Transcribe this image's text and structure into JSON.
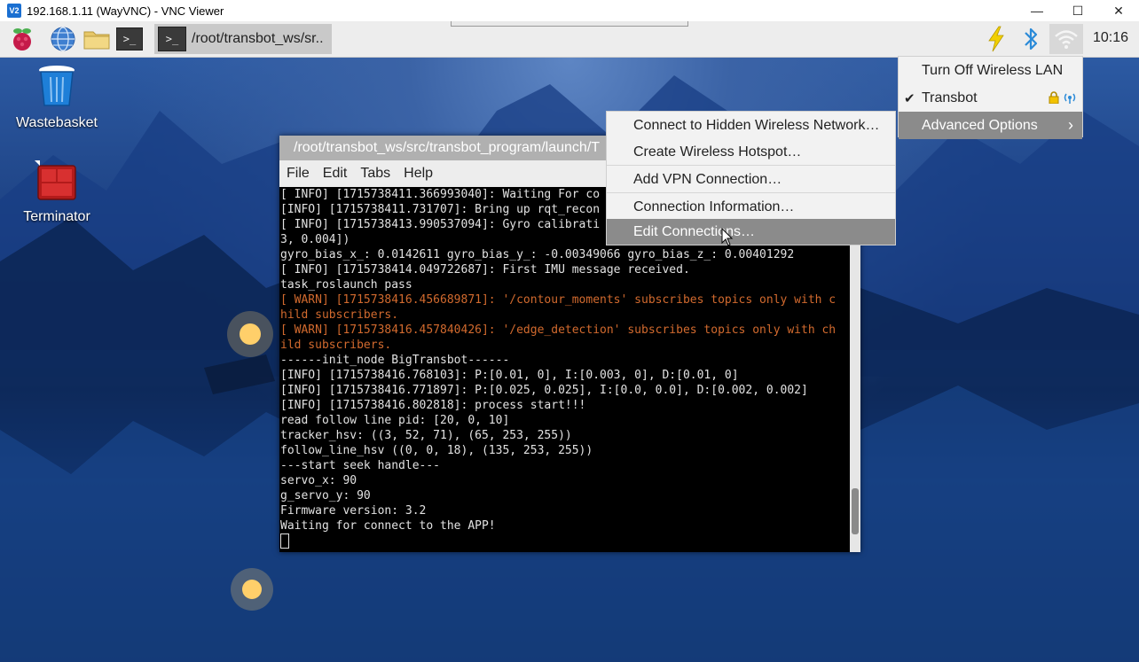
{
  "vnc": {
    "title": "192.168.1.11 (WayVNC) - VNC Viewer",
    "logo": "V2",
    "minimize": "—",
    "maximize": "☐",
    "close": "✕"
  },
  "taskbar": {
    "launchers": [
      "raspberry-pi-menu-icon",
      "web-browser-icon",
      "file-manager-icon",
      "terminal-icon"
    ],
    "task_title": "/root/transbot_ws/sr..",
    "clock": "10:16",
    "tray_icons": [
      "lightning-icon",
      "bluetooth-icon",
      "wifi-icon"
    ]
  },
  "desktop": {
    "icons": [
      {
        "label": "Wastebasket"
      },
      {
        "label": "Terminator"
      }
    ]
  },
  "terminal": {
    "title": "/root/transbot_ws/src/transbot_program/launch/T",
    "menu": [
      "File",
      "Edit",
      "Tabs",
      "Help"
    ],
    "lines": [
      {
        "text": "[ INFO] [1715738411.366993040]: Waiting For co",
        "warn": false
      },
      {
        "text": "[INFO] [1715738411.731707]: Bring up rqt_recon",
        "warn": false
      },
      {
        "text": "[ INFO] [1715738413.990537094]: Gyro calibrati",
        "warn": false
      },
      {
        "text": "3, 0.004])",
        "warn": false
      },
      {
        "text": "gyro_bias_x_: 0.0142611 gyro_bias_y_: -0.00349066 gyro_bias_z_: 0.00401292",
        "warn": false
      },
      {
        "text": "[ INFO] [1715738414.049722687]: First IMU message received.",
        "warn": false
      },
      {
        "text": "task_roslaunch pass",
        "warn": false
      },
      {
        "text": "[ WARN] [1715738416.456689871]: '/contour_moments' subscribes topics only with c",
        "warn": true
      },
      {
        "text": "hild subscribers.",
        "warn": true
      },
      {
        "text": "[ WARN] [1715738416.457840426]: '/edge_detection' subscribes topics only with ch",
        "warn": true
      },
      {
        "text": "ild subscribers.",
        "warn": true
      },
      {
        "text": "------init_node BigTransbot------",
        "warn": false
      },
      {
        "text": "[INFO] [1715738416.768103]: P:[0.01, 0], I:[0.003, 0], D:[0.01, 0]",
        "warn": false
      },
      {
        "text": "[INFO] [1715738416.771897]: P:[0.025, 0.025], I:[0.0, 0.0], D:[0.002, 0.002]",
        "warn": false
      },
      {
        "text": "[INFO] [1715738416.802818]: process start!!!",
        "warn": false
      },
      {
        "text": "read follow line pid: [20, 0, 10]",
        "warn": false
      },
      {
        "text": "tracker_hsv: ((3, 52, 71), (65, 253, 255))",
        "warn": false
      },
      {
        "text": "follow_line_hsv ((0, 0, 18), (135, 253, 255))",
        "warn": false
      },
      {
        "text": "---start seek handle---",
        "warn": false
      },
      {
        "text": "servo_x: 90",
        "warn": false
      },
      {
        "text": "g_servo_y: 90",
        "warn": false
      },
      {
        "text": "Firmware version: 3.2",
        "warn": false
      },
      {
        "text": "Waiting for connect to the APP!",
        "warn": false
      }
    ]
  },
  "network_menu": {
    "turn_off": "Turn Off Wireless LAN",
    "network": "Transbot",
    "network_checked": "✔",
    "advanced": "Advanced Options",
    "advanced_chevron": "›"
  },
  "advanced_submenu": {
    "items": [
      "Connect to Hidden Wireless Network…",
      "Create Wireless Hotspot…",
      "Add VPN Connection…",
      "Connection Information…",
      "Edit Connections…"
    ]
  },
  "colors": {
    "warn_text": "#d26a2e",
    "menu_highlight": "#8b8b8b",
    "bluetooth": "#2a8ad8",
    "bolt": "#f2d000"
  }
}
